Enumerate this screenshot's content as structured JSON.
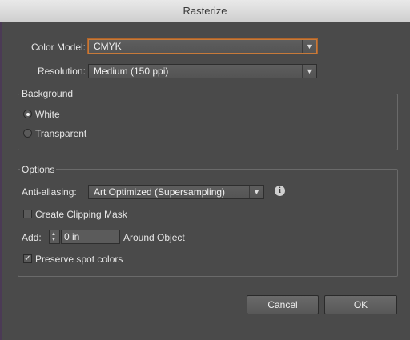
{
  "window": {
    "title": "Rasterize"
  },
  "color_model": {
    "label": "Color Model:",
    "value": "CMYK"
  },
  "resolution": {
    "label": "Resolution:",
    "value": "Medium (150 ppi)"
  },
  "background": {
    "title": "Background",
    "options": [
      {
        "label": "White",
        "selected": true
      },
      {
        "label": "Transparent",
        "selected": false
      }
    ]
  },
  "options": {
    "title": "Options",
    "anti_aliasing": {
      "label": "Anti-aliasing:",
      "value": "Art Optimized (Supersampling)"
    },
    "clipping_mask": {
      "label": "Create Clipping Mask",
      "checked": false
    },
    "add": {
      "label": "Add:",
      "value": "0 in",
      "suffix": "Around Object"
    },
    "preserve_spot": {
      "label": "Preserve spot colors",
      "checked": true
    }
  },
  "buttons": {
    "cancel": "Cancel",
    "ok": "OK"
  },
  "icons": {
    "dropdown": "dropdown-arrow-icon",
    "info": "info-icon",
    "check": "checkmark-icon",
    "stepper": "stepper-arrows-icon"
  },
  "colors": {
    "focus_ring": "#c77a3a",
    "dialog_bg": "#4a4a4a"
  }
}
